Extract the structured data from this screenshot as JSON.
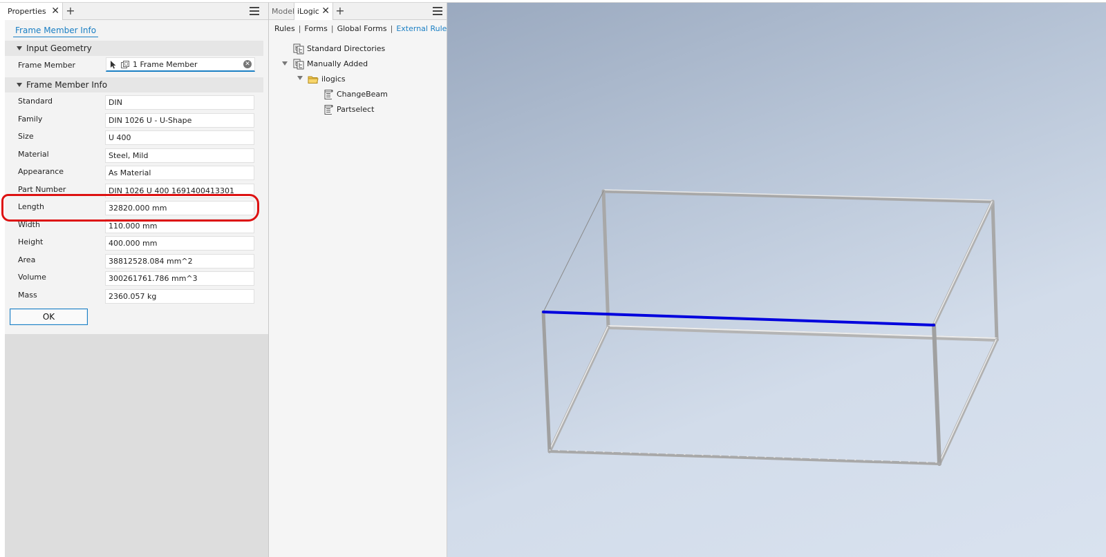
{
  "properties_panel": {
    "tab_label": "Properties",
    "link": "Frame Member Info",
    "section_input_geometry": "Input Geometry",
    "frame_member_label": "Frame Member",
    "frame_member_value": "1 Frame Member",
    "section_frame_member_info": "Frame Member Info",
    "rows": [
      {
        "label": "Standard",
        "value": "DIN"
      },
      {
        "label": "Family",
        "value": "DIN 1026 U - U-Shape"
      },
      {
        "label": "Size",
        "value": "U 400"
      },
      {
        "label": "Material",
        "value": "Steel, Mild"
      },
      {
        "label": "Appearance",
        "value": "As Material"
      },
      {
        "label": "Part Number",
        "value": "DIN 1026 U 400 1691400413301"
      },
      {
        "label": "Length",
        "value": "32820.000 mm"
      },
      {
        "label": "Width",
        "value": "110.000 mm"
      },
      {
        "label": "Height",
        "value": "400.000 mm"
      },
      {
        "label": "Area",
        "value": "38812528.084 mm^2"
      },
      {
        "label": "Volume",
        "value": "300261761.786 mm^3"
      },
      {
        "label": "Mass",
        "value": "2360.057 kg"
      }
    ],
    "ok_label": "OK",
    "highlighted_row": "Length",
    "highlight_color": "#dd1111"
  },
  "ilogic_panel": {
    "model_tab": "Model",
    "ilogic_tab": "iLogic",
    "subnav": {
      "rules": "Rules",
      "forms": "Forms",
      "global_forms": "Global Forms",
      "external_rules": "External Rules"
    },
    "tree": {
      "standard_directories": "Standard Directories",
      "manually_added": "Manually Added",
      "folder": "ilogics",
      "rule_1": "ChangeBeam",
      "rule_2": "Partselect"
    }
  },
  "viewport": {
    "selected_edge_color": "#0000dd",
    "frame_color": "#c0c0c0",
    "background_top": "#9aa9bf",
    "background_bottom": "#d9e2ef"
  },
  "colors": {
    "accent": "#1a7fc4"
  }
}
